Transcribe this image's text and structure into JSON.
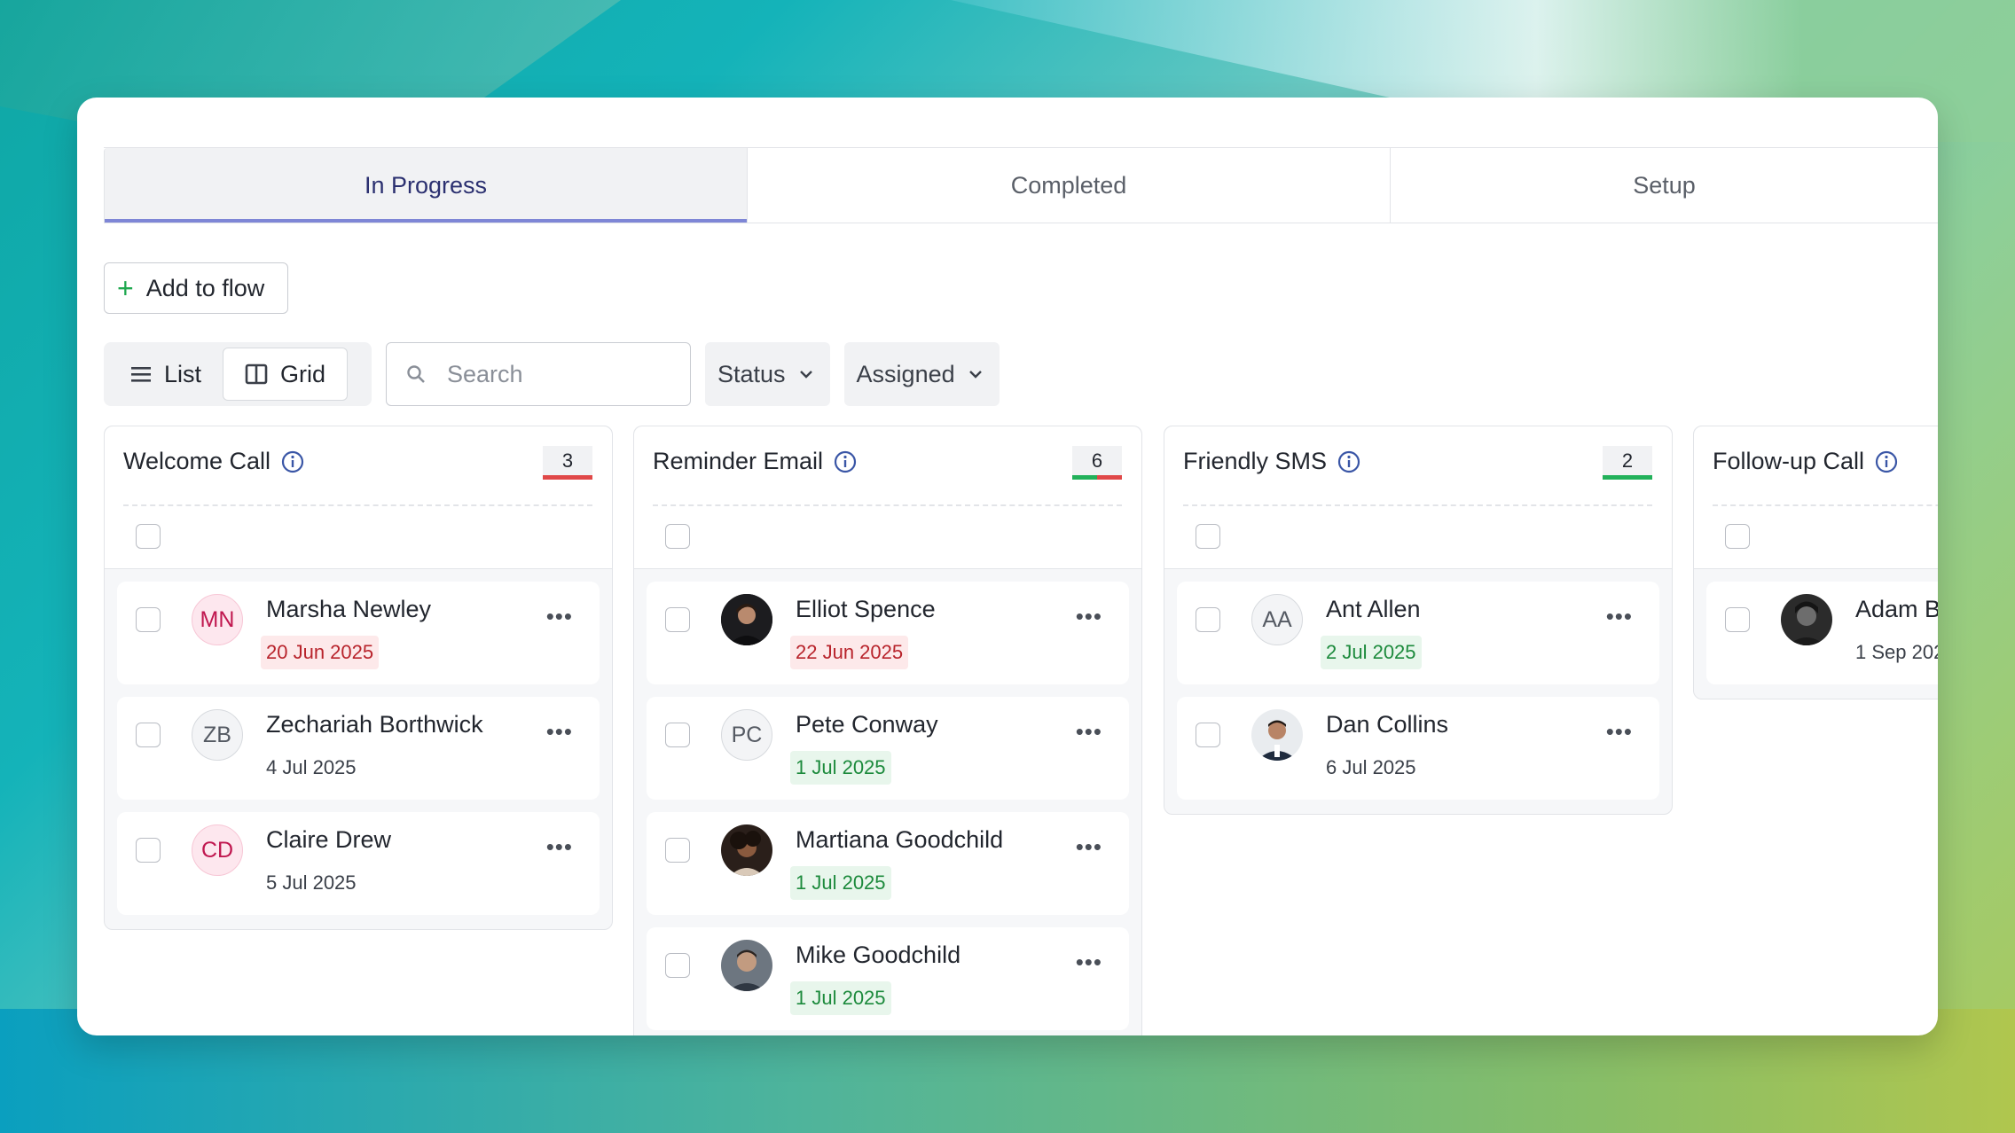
{
  "tabs": [
    {
      "label": "In Progress",
      "active": true
    },
    {
      "label": "Completed",
      "active": false
    },
    {
      "label": "Setup",
      "active": false
    }
  ],
  "add_button": {
    "label": "Add to flow",
    "icon": "plus-icon"
  },
  "view_toggle": {
    "list_label": "List",
    "grid_label": "Grid",
    "selected": "Grid"
  },
  "search": {
    "placeholder": "Search",
    "value": ""
  },
  "filters": {
    "status_label": "Status",
    "assigned_label": "Assigned"
  },
  "colors": {
    "accent": "#7e86d6",
    "red": "#e04848",
    "green": "#22b15a",
    "pink_avatar": "#c0174f"
  },
  "columns": [
    {
      "title": "Welcome Call",
      "count": "3",
      "cards": [
        {
          "name": "Marsha Newley",
          "initials": "MN",
          "date": "20 Jun 2025",
          "date_status": "overdue"
        },
        {
          "name": "Zechariah Borthwick",
          "initials": "ZB",
          "date": "4 Jul 2025",
          "date_status": "none"
        },
        {
          "name": "Claire Drew",
          "initials": "CD",
          "date": "5 Jul 2025",
          "date_status": "none"
        }
      ]
    },
    {
      "title": "Reminder Email",
      "count": "6",
      "cards": [
        {
          "name": "Elliot Spence",
          "initials": "",
          "date": "22 Jun 2025",
          "date_status": "overdue"
        },
        {
          "name": "Pete Conway",
          "initials": "PC",
          "date": "1 Jul 2025",
          "date_status": "upcoming"
        },
        {
          "name": "Martiana Goodchild",
          "initials": "",
          "date": "1 Jul 2025",
          "date_status": "upcoming"
        },
        {
          "name": "Mike Goodchild",
          "initials": "",
          "date": "1 Jul 2025",
          "date_status": "upcoming"
        }
      ]
    },
    {
      "title": "Friendly SMS",
      "count": "2",
      "cards": [
        {
          "name": "Ant Allen",
          "initials": "AA",
          "date": "2 Jul 2025",
          "date_status": "upcoming"
        },
        {
          "name": "Dan Collins",
          "initials": "",
          "date": "6 Jul 2025",
          "date_status": "none"
        }
      ]
    },
    {
      "title": "Follow-up Call",
      "count": "",
      "cards": [
        {
          "name": "Adam Ba",
          "initials": "",
          "date": "1 Sep 202",
          "date_status": "none"
        }
      ]
    }
  ]
}
